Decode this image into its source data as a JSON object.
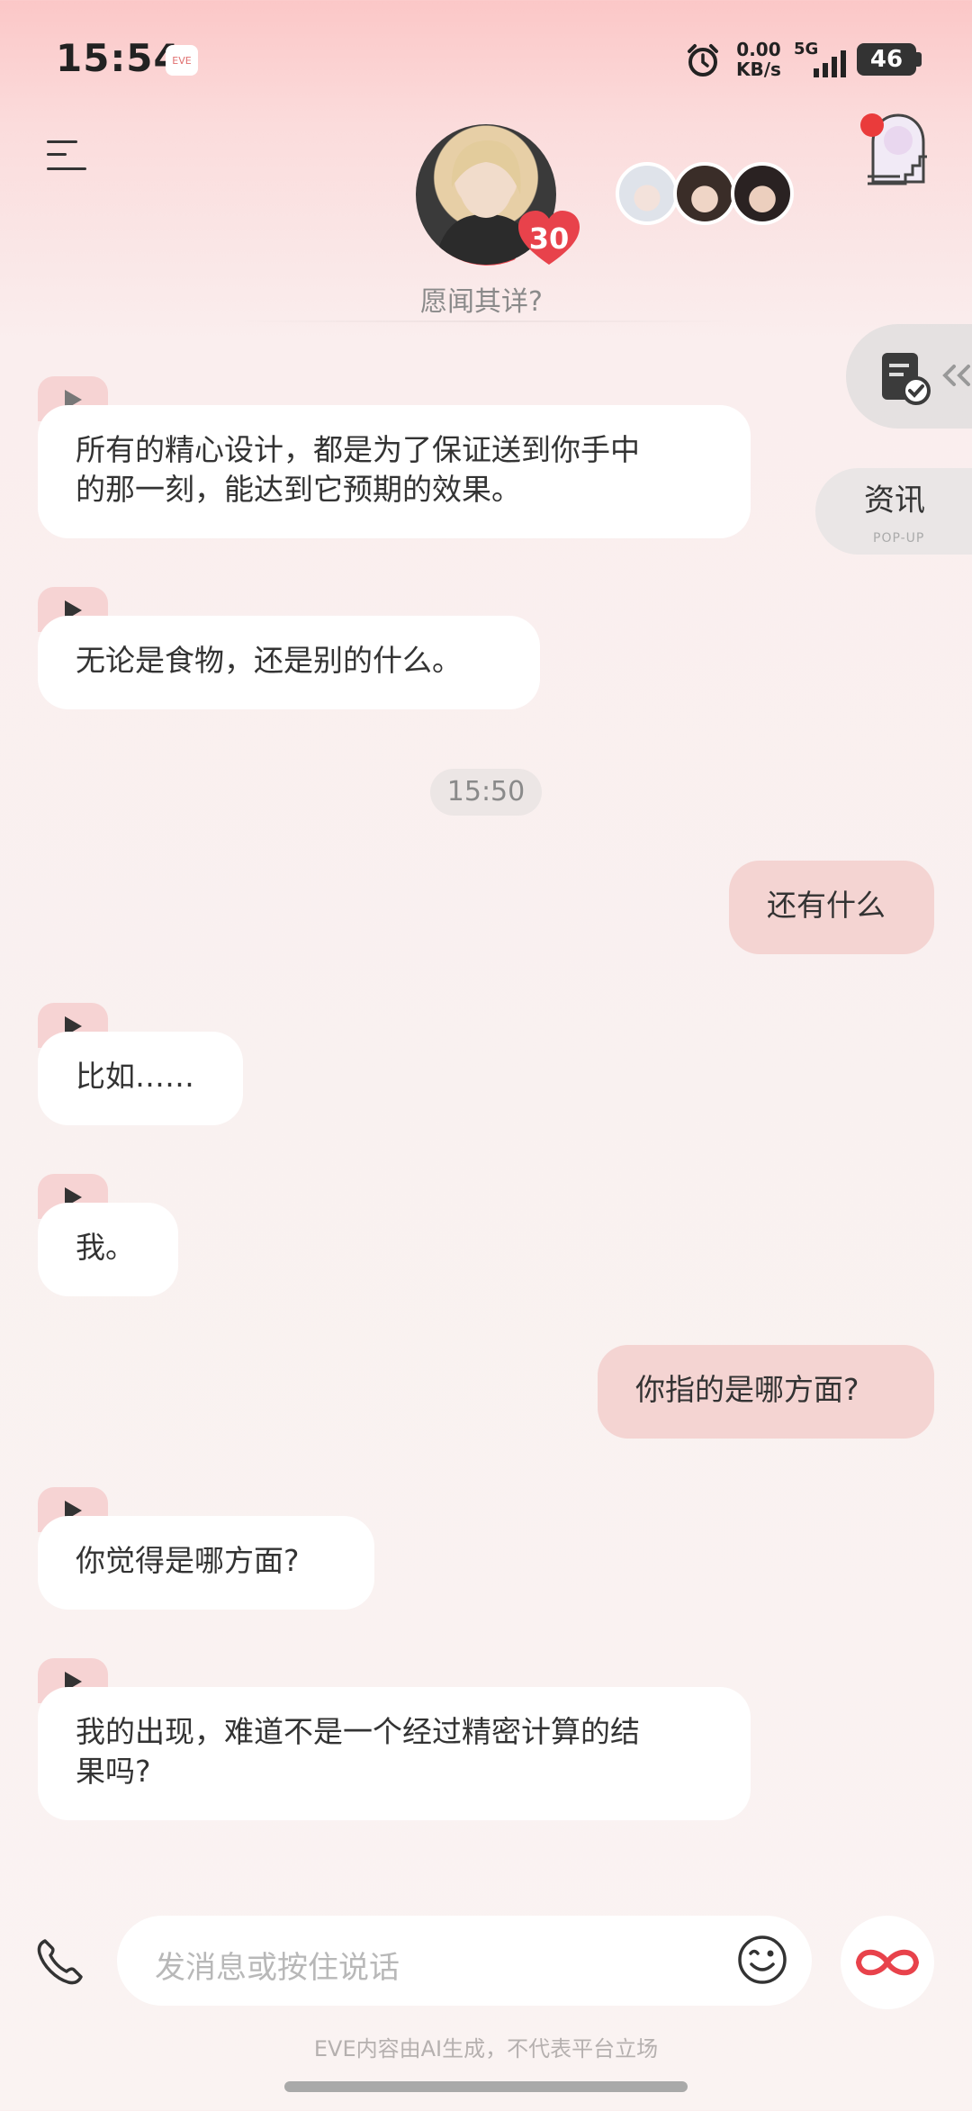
{
  "status": {
    "time": "15:54",
    "app_chip": "EVE",
    "net_speed_value": "0.00",
    "net_speed_unit": "KB/s",
    "network": "5G",
    "battery": "46"
  },
  "header": {
    "affinity": "30",
    "subtitle": "愿闻其详?"
  },
  "side": {
    "info_label": "资讯",
    "info_sub": "POP-UP"
  },
  "messages": [
    {
      "from": "ai",
      "text_lines": [
        "所有的精心设计，都是为了保证送到你手中",
        "的那一刻，能达到它预期的效果。"
      ]
    },
    {
      "from": "ai",
      "text": "无论是食物，还是别的什么。"
    },
    {
      "type": "time",
      "text": "15:50"
    },
    {
      "from": "me",
      "text": "还有什么"
    },
    {
      "from": "ai",
      "text": "比如……"
    },
    {
      "from": "ai",
      "text": "我。"
    },
    {
      "from": "me",
      "text": "你指的是哪方面?"
    },
    {
      "from": "ai",
      "text": "你觉得是哪方面?"
    },
    {
      "from": "ai",
      "text_lines": [
        "我的出现，难道不是一个经过精密计算的结",
        "果吗?"
      ]
    }
  ],
  "input": {
    "placeholder": "发消息或按住说话"
  },
  "footer": {
    "disclaimer": "EVE内容由AI生成，不代表平台立场"
  },
  "colors": {
    "accent": "#e8424b",
    "user_bubble": "#f4d4d2",
    "ai_bubble": "#ffffff",
    "play_tab": "#f6d3d3"
  },
  "icons": [
    "menu-icon",
    "alarm-icon",
    "signal-icon",
    "portal-icon",
    "task-check-icon",
    "play-icon",
    "phone-icon",
    "emoji-icon",
    "infinity-icon"
  ]
}
